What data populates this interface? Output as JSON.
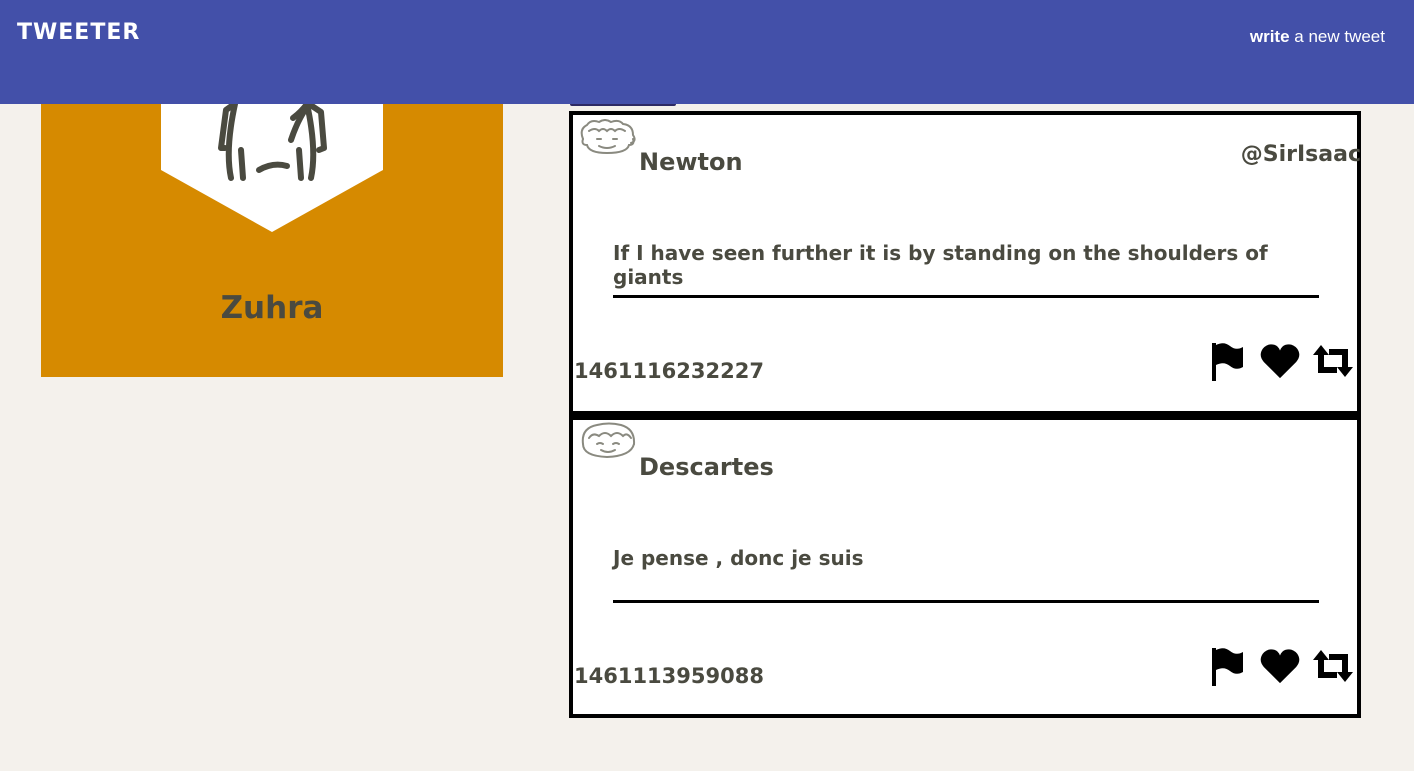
{
  "header": {
    "brand": "TWEETER",
    "compose_bold": "write",
    "compose_rest": " a new tweet",
    "background": "#4350a9"
  },
  "profile": {
    "name": "Zuhra",
    "card_color": "#d68a00",
    "avatar_icon": "person-shield-icon"
  },
  "tweets": [
    {
      "name": "Newton",
      "handle": "@SirIsaac",
      "text": "If I have seen further it is by standing on the shoulders of giants",
      "timestamp": "1461116232227",
      "avatar_icon": "curly-hair-face-icon"
    },
    {
      "name": "Descartes",
      "handle": "",
      "text": "Je pense , donc je suis",
      "timestamp": "1461113959088",
      "avatar_icon": "bangs-face-icon"
    }
  ],
  "actions": {
    "flag_icon": "flag-icon",
    "like_icon": "heart-icon",
    "retweet_icon": "retweet-icon"
  }
}
